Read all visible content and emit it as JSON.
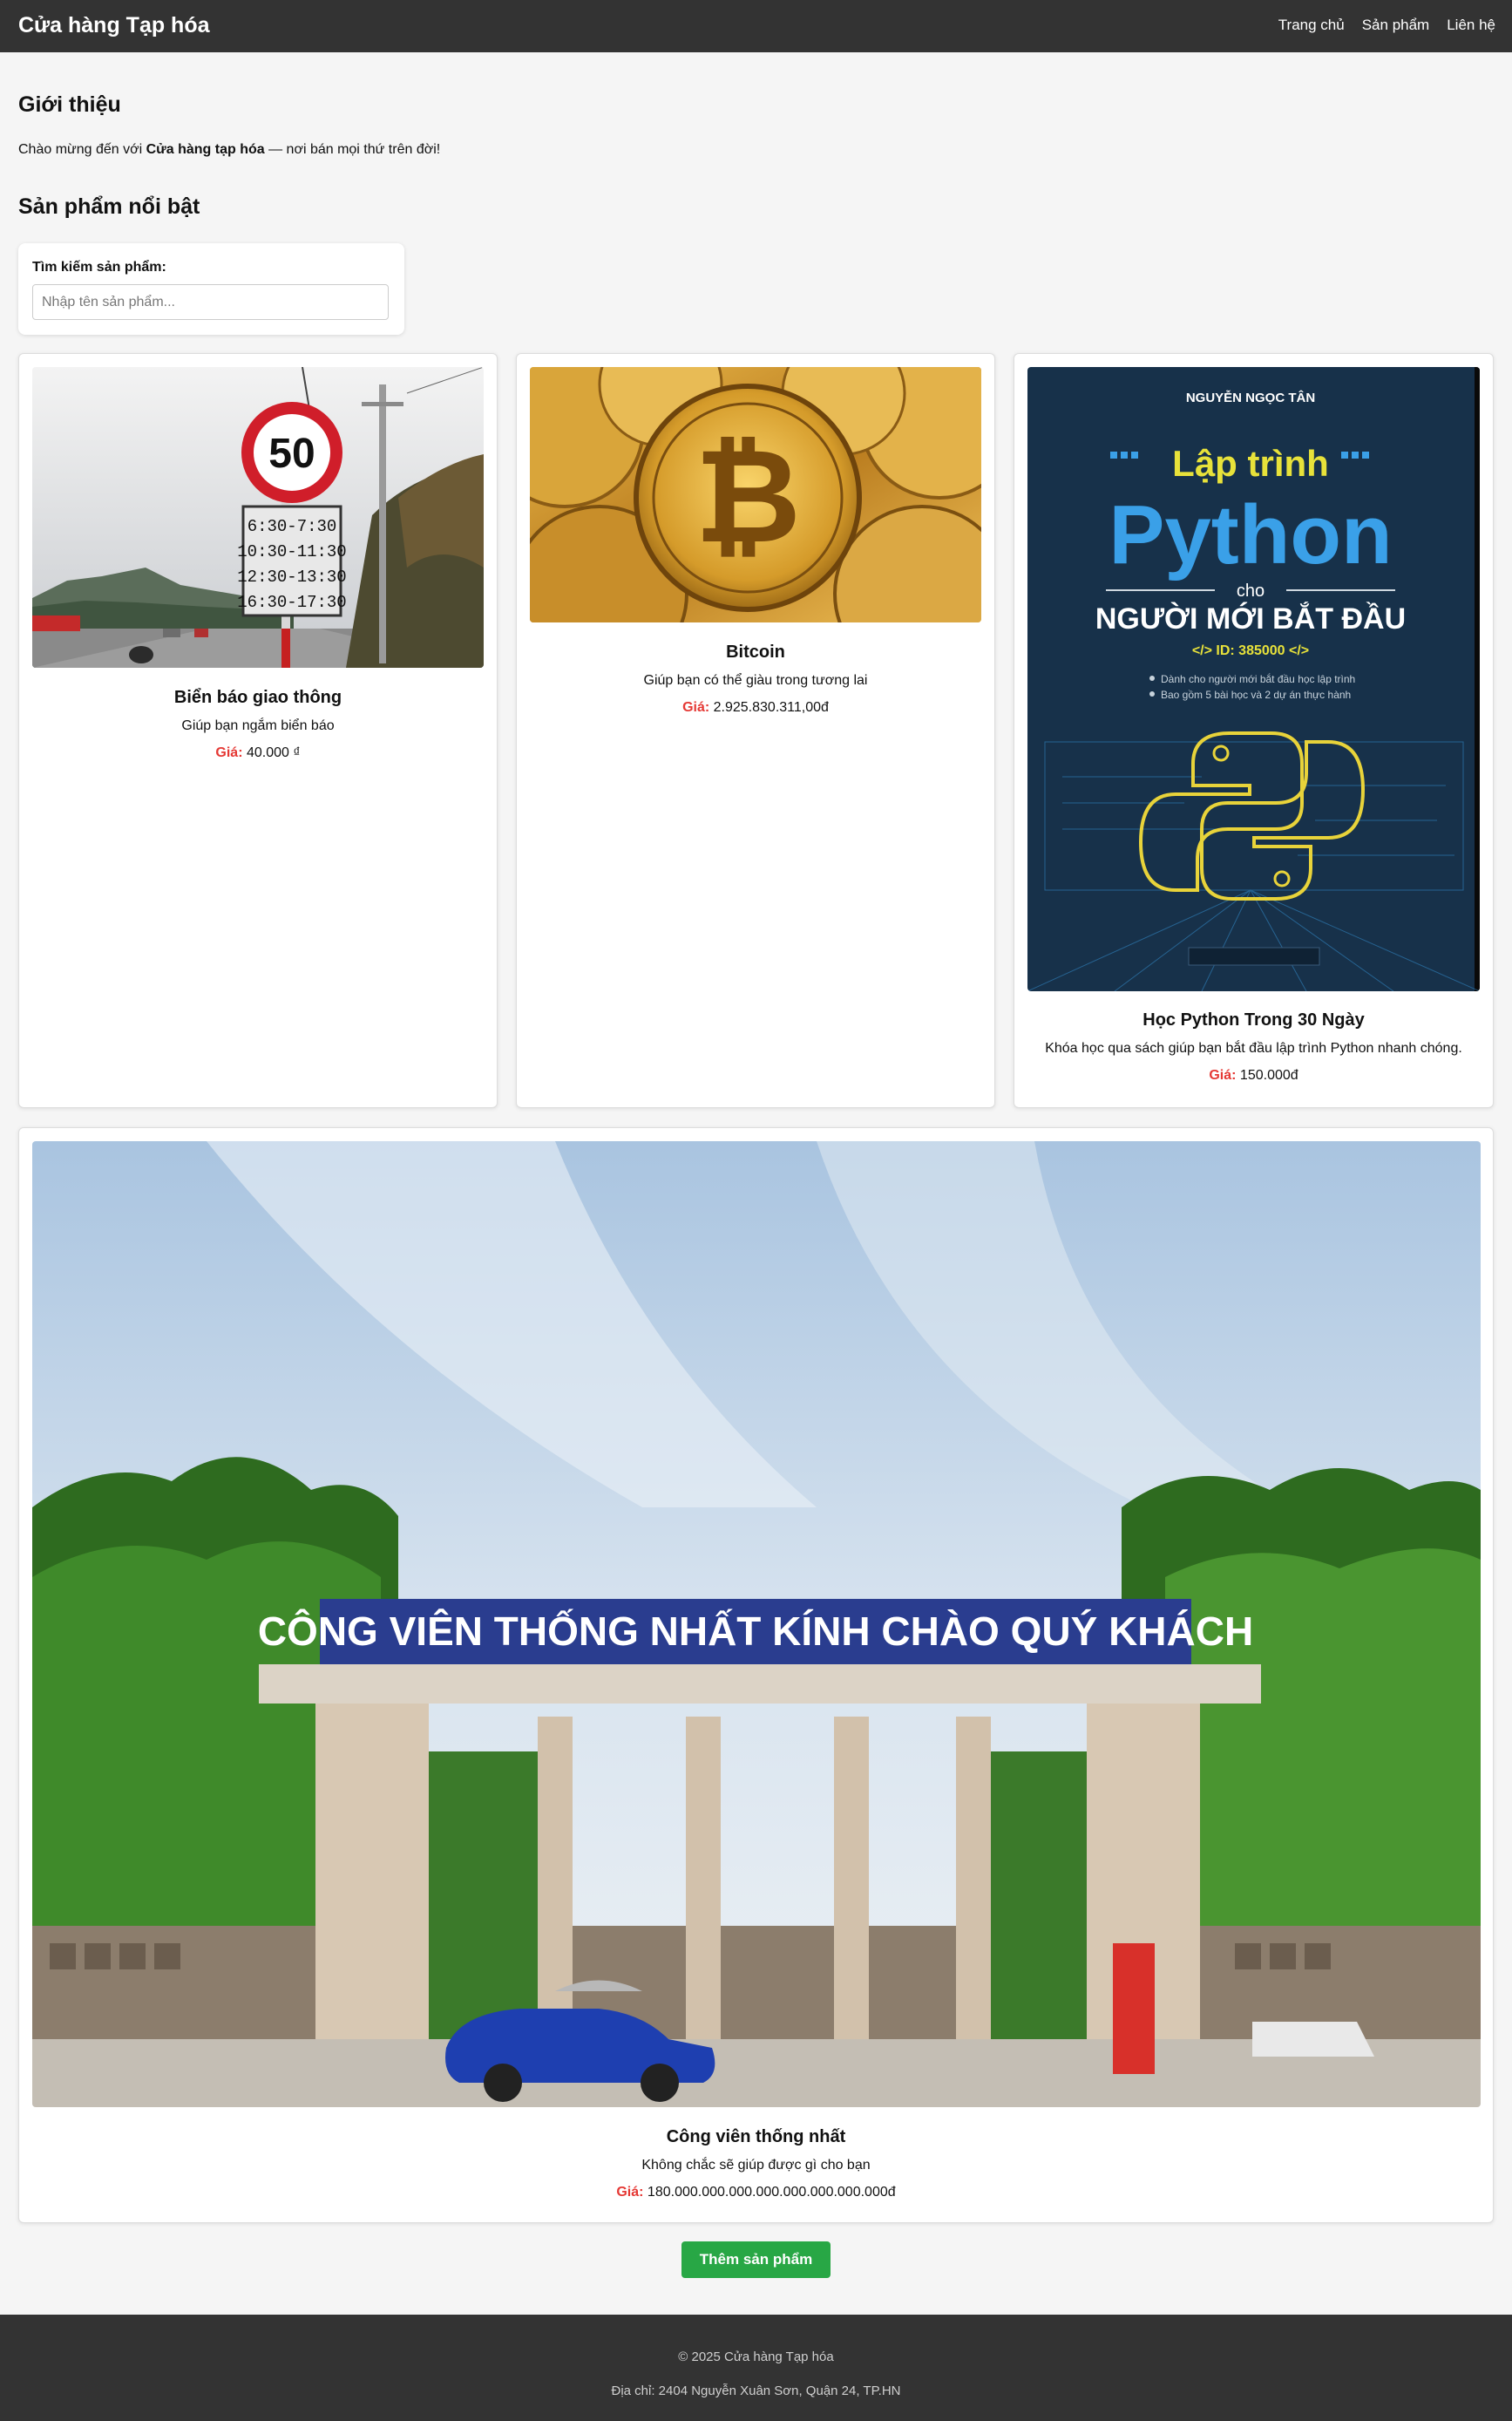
{
  "header": {
    "brand": "Cửa hàng Tạp hóa",
    "nav": [
      "Trang chủ",
      "Sản phẩm",
      "Liên hệ"
    ]
  },
  "intro": {
    "title": "Giới thiệu",
    "text_before": "Chào mừng đến với ",
    "text_bold": "Cửa hàng tạp hóa",
    "text_after": " — nơi bán mọi thứ trên đời!"
  },
  "featured": {
    "title": "Sản phẩm nổi bật"
  },
  "search": {
    "label": "Tìm kiếm sản phẩm:",
    "placeholder": "Nhập tên sản phẩm..."
  },
  "price_label": "Giá:",
  "products": [
    {
      "name": "Biển báo giao thông",
      "desc": "Giúp bạn ngắm biển báo",
      "price": "40.000 ₫",
      "image": {
        "speed": "50",
        "times": [
          "6:30-7:30",
          "10:30-11:30",
          "12:30-13:30",
          "16:30-17:30"
        ]
      }
    },
    {
      "name": "Bitcoin",
      "desc": "Giúp bạn có thể giàu trong tương lai",
      "price": "2.925.830.311,00đ",
      "image": {
        "symbol": "₿"
      }
    },
    {
      "name": "Học Python Trong 30 Ngày",
      "desc": "Khóa học qua sách giúp bạn bắt đầu lập trình Python nhanh chóng.",
      "price": "150.000đ",
      "image": {
        "author": "NGUYỄN NGỌC TÂN",
        "line1": "Lập trình",
        "line2": "Python",
        "line3": "cho",
        "line4": "NGƯỜI MỚI BẮT ĐẦU",
        "line5": "</> ID: 385000 </>",
        "bullet1": "Dành cho người mới bắt đầu học lập trình",
        "bullet2": "Bao gồm 5 bài học và 2 dự án thực hành"
      }
    },
    {
      "name": "Công viên thống nhất",
      "desc": "Không chắc sẽ giúp được gì cho bạn",
      "price": "180.000.000.000.000.000.000.000.000đ",
      "image": {
        "banner": "CÔNG VIÊN THỐNG NHẤT KÍNH CHÀO QUÝ KHÁCH"
      }
    }
  ],
  "add_button": "Thêm sản phẩm",
  "footer": {
    "copyright": "© 2025 Cửa hàng Tạp hóa",
    "address": "Địa chỉ: 2404 Nguyễn Xuân Sơn, Quận 24, TP.HN"
  }
}
